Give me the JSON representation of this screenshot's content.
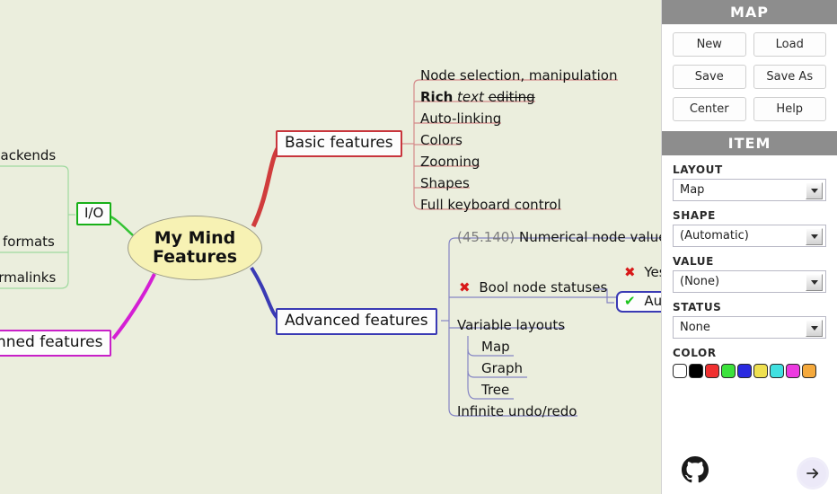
{
  "canvas": {
    "background_color": "#ebeedd",
    "root": {
      "label": "My Mind\nFeatures",
      "line1": "My Mind",
      "line2": "Features",
      "fill": "#f7f2b4",
      "border": "#9a9a86"
    },
    "branches": {
      "basic": {
        "label": "Basic features",
        "color": "#c8353c",
        "children": [
          {
            "label": "Node selection, manipulation"
          },
          {
            "label": "Rich text editing",
            "rich": true,
            "parts": [
              {
                "text": "Rich",
                "style": "bold"
              },
              {
                "text": "text",
                "style": "italic"
              },
              {
                "text": "editing",
                "style": "strikethrough"
              }
            ]
          },
          {
            "label": "Auto-linking"
          },
          {
            "label": "Colors"
          },
          {
            "label": "Zooming"
          },
          {
            "label": "Shapes"
          },
          {
            "label": "Full keyboard control"
          }
        ]
      },
      "advanced": {
        "label": "Advanced features",
        "color": "#3a3ab4",
        "children": [
          {
            "label": "Numerical node values",
            "value": "(45.140)",
            "clipped": true
          },
          {
            "label": "Bool node statuses",
            "status": "x"
          },
          {
            "label": "Yes",
            "status": "x",
            "clipped": true
          },
          {
            "label": "Au",
            "status": "ok",
            "clipped": true,
            "boxed": true
          },
          {
            "label": "Variable layouts",
            "children": [
              {
                "label": "Map"
              },
              {
                "label": "Graph"
              },
              {
                "label": "Tree"
              }
            ]
          },
          {
            "label": "Infinite undo/redo"
          }
        ]
      },
      "io": {
        "label": "I/O",
        "color": "#18b018",
        "children": [
          {
            "label": "backends",
            "clipped": true
          },
          {
            "label": "e formats",
            "clipped": true
          },
          {
            "label": "ermalinks",
            "clipped": true
          }
        ]
      },
      "planned": {
        "label": "nned features",
        "color": "#c81fc8",
        "clipped": true
      }
    }
  },
  "panel": {
    "map": {
      "title": "MAP",
      "buttons": [
        {
          "label": "New"
        },
        {
          "label": "Load"
        },
        {
          "label": "Save"
        },
        {
          "label": "Save As"
        },
        {
          "label": "Center"
        },
        {
          "label": "Help"
        }
      ]
    },
    "item": {
      "title": "ITEM",
      "fields": [
        {
          "label": "LAYOUT",
          "value": "Map"
        },
        {
          "label": "SHAPE",
          "value": "(Automatic)"
        },
        {
          "label": "VALUE",
          "value": "(None)"
        },
        {
          "label": "STATUS",
          "value": "None"
        }
      ],
      "color_label": "COLOR",
      "colors": [
        "#ffffff",
        "#000000",
        "#f03030",
        "#3ce23c",
        "#2a2ae0",
        "#efe050",
        "#40e0e0",
        "#ec3ae0",
        "#f5a93c"
      ]
    },
    "footer": {
      "github": "github-icon",
      "next": "arrow-right-icon"
    }
  }
}
